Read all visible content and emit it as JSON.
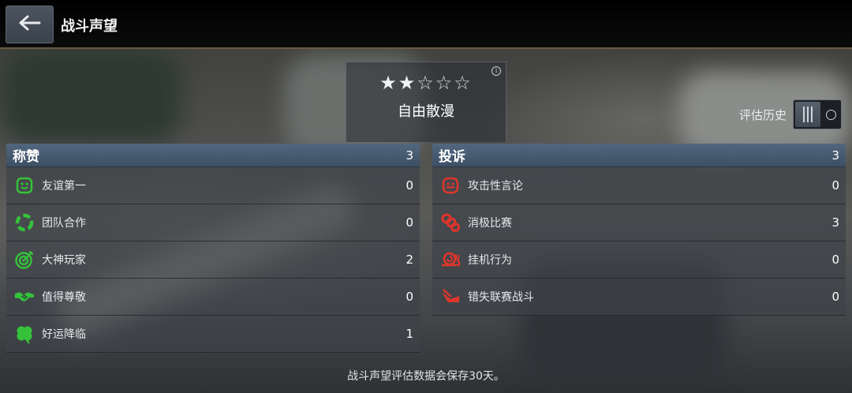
{
  "header": {
    "title": "战斗声望"
  },
  "rank": {
    "stars_filled": 2,
    "stars_total": 5,
    "filled_star": "★",
    "empty_star": "☆",
    "name": "自由散漫",
    "info_glyph": "i"
  },
  "history": {
    "label": "评估历史",
    "toggle_on": true
  },
  "praise": {
    "title": "称赞",
    "count": "3",
    "items": [
      {
        "label": "友谊第一",
        "value": "0",
        "icon": "friendship-icon"
      },
      {
        "label": "团队合作",
        "value": "0",
        "icon": "teamwork-icon"
      },
      {
        "label": "大神玩家",
        "value": "2",
        "icon": "target-icon"
      },
      {
        "label": "值得尊敬",
        "value": "0",
        "icon": "handshake-icon"
      },
      {
        "label": "好运降临",
        "value": "1",
        "icon": "clover-icon"
      }
    ]
  },
  "complaints": {
    "title": "投诉",
    "count": "3",
    "items": [
      {
        "label": "攻击性言论",
        "value": "0",
        "icon": "offensive-speech-icon"
      },
      {
        "label": "消极比赛",
        "value": "3",
        "icon": "negative-play-icon"
      },
      {
        "label": "挂机行为",
        "value": "0",
        "icon": "snail-icon"
      },
      {
        "label": "错失联赛战斗",
        "value": "0",
        "icon": "missed-battle-icon"
      }
    ]
  },
  "footer": {
    "note": "战斗声望评估数据会保存30天。"
  },
  "colors": {
    "praise_icon": "#35c23a",
    "complaint_icon": "#e0352b",
    "header_bar": "#4a5f76"
  }
}
